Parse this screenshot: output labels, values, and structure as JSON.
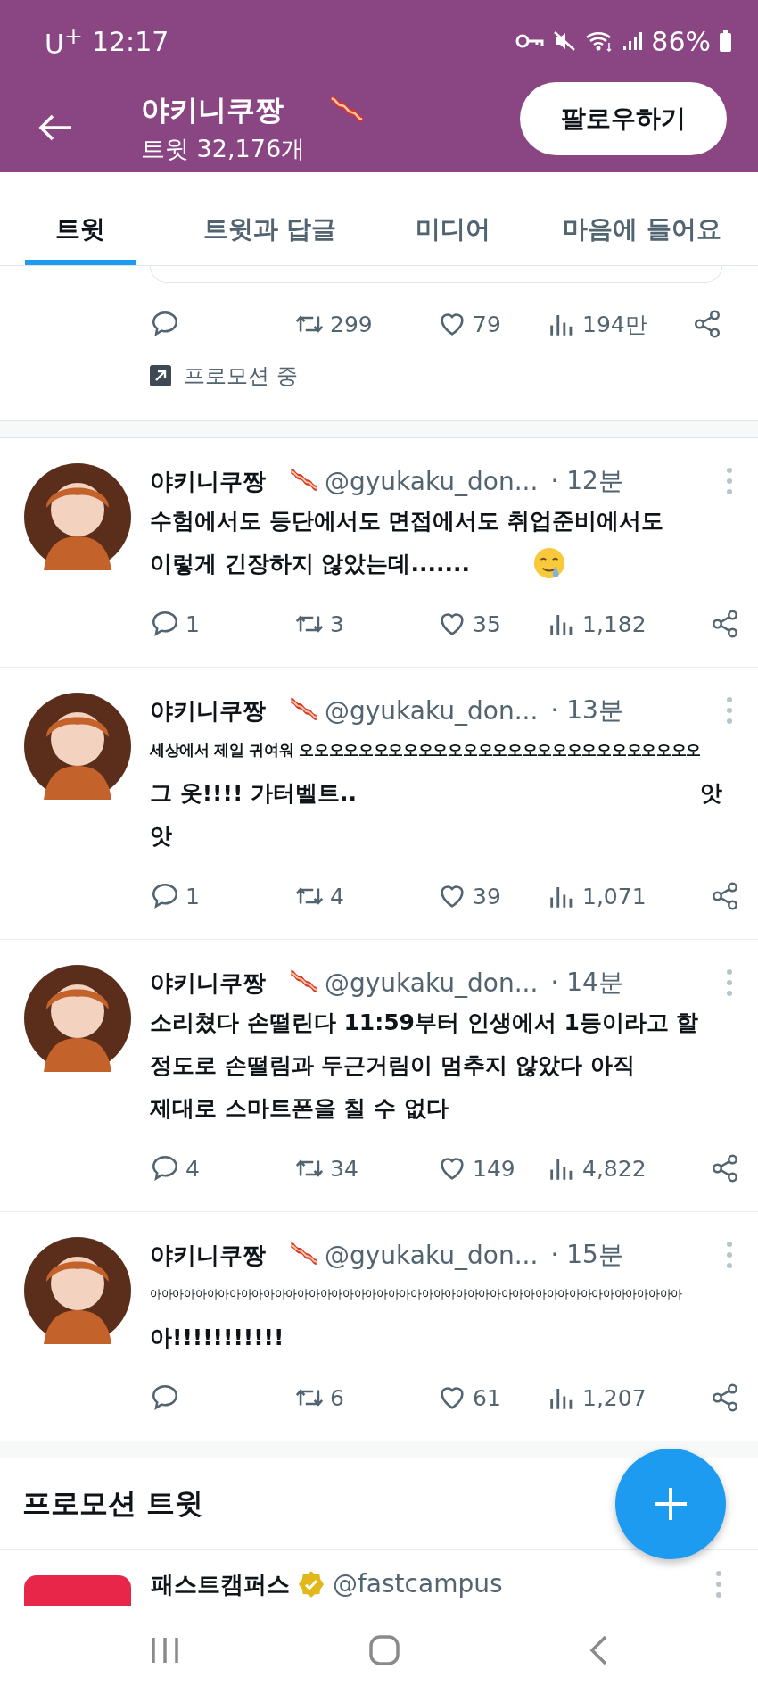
{
  "status_bar": {
    "carrier": "U$^{+}$",
    "time": "12:17",
    "battery": "86%"
  },
  "header": {
    "name": "야키니쿠짱",
    "tweet_count": "트윗 32,176개",
    "follow_button": "팔로우하기"
  },
  "tabs": [
    {
      "label": "트윗",
      "selected": true
    },
    {
      "label": "트윗과 답글",
      "selected": false
    },
    {
      "label": "미디어",
      "selected": false
    },
    {
      "label": "마음에 들어요",
      "selected": false
    }
  ],
  "pinned_tweet": {
    "retweets": "299",
    "likes": "79",
    "views": "194만",
    "promo_label": "프로모션 중"
  },
  "tweets": [
    {
      "name": "야키니쿠짱",
      "handle": "@gyukaku_don...",
      "time": "· 12분",
      "emoji": true,
      "lines": [
        {
          "kind": "normal",
          "text": "수험에서도 등단에서도 면접에서도 취업준비에서도"
        },
        {
          "kind": "normal",
          "text": "이렇게 긴장하지 않았는데......."
        }
      ],
      "replies": "1",
      "retweets": "3",
      "likes": "35",
      "views": "1,182"
    },
    {
      "name": "야키니쿠짱",
      "handle": "@gyukaku_don...",
      "time": "· 13분",
      "emoji": false,
      "lines": [
        {
          "kind": "small",
          "text": "세상에서 제일 귀여워 오오오오오오오오오오오오오오오오오오오오오오오오오오오"
        },
        {
          "kind": "normal",
          "text": "그 옷!!!! 가터벨트..",
          "right": "앗"
        },
        {
          "kind": "normal",
          "text": "앗"
        }
      ],
      "replies": "1",
      "retweets": "4",
      "likes": "39",
      "views": "1,071"
    },
    {
      "name": "야키니쿠짱",
      "handle": "@gyukaku_don...",
      "time": "· 14분",
      "emoji": false,
      "lines": [
        {
          "kind": "normal",
          "text": "소리쳤다 손떨린다 11:59부터 인생에서 1등이라고 할"
        },
        {
          "kind": "normal",
          "text": "정도로 손떨림과 두근거림이 멈추지 않았다 아직"
        },
        {
          "kind": "normal",
          "text": "제대로 스마트폰을 칠 수 없다"
        }
      ],
      "replies": "4",
      "retweets": "34",
      "likes": "149",
      "views": "4,822"
    },
    {
      "name": "야키니쿠짱",
      "handle": "@gyukaku_don...",
      "time": "· 15분",
      "emoji": false,
      "lines": [
        {
          "kind": "tiny",
          "text": "아아아아아아아아아아아아아아아아아아아아아아아아아아아아아아아아아아아아아아아아아아아아아아아"
        },
        {
          "kind": "normal",
          "text": "아!!!!!!!!!!!"
        }
      ],
      "retweets": "6",
      "likes": "61",
      "views": "1,207"
    }
  ],
  "promoted_section": {
    "title": "프로모션 트윗",
    "tweet": {
      "name": "패스트캠퍼스",
      "verified": true,
      "handle": "@fastcampus"
    }
  }
}
